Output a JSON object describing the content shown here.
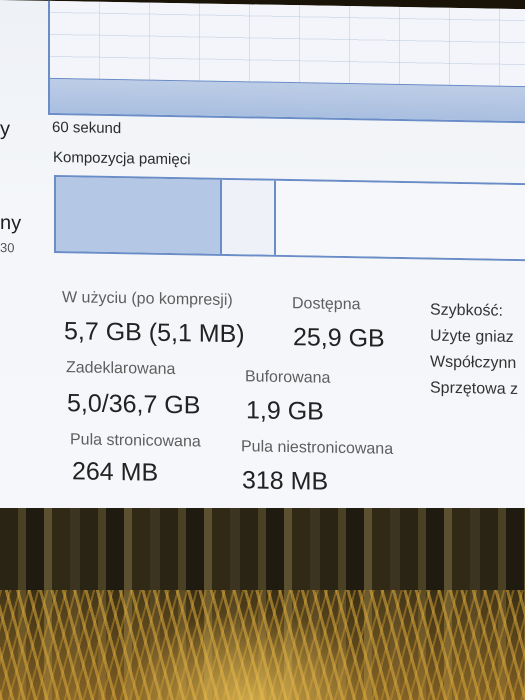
{
  "left_fragments": [
    "y",
    "ny",
    "30"
  ],
  "graph": {
    "time_label": "60 sekund"
  },
  "composition": {
    "title": "Kompozycja pamięci"
  },
  "stats": {
    "in_use": {
      "label": "W użyciu (po kompresji)",
      "value": "5,7 GB (5,1 MB)"
    },
    "available": {
      "label": "Dostępna",
      "value": "25,9 GB"
    },
    "committed": {
      "label": "Zadeklarowana",
      "value": "5,0/36,7 GB"
    },
    "cached": {
      "label": "Buforowana",
      "value": "1,9 GB"
    },
    "paged_pool": {
      "label": "Pula stronicowana",
      "value": "264 MB"
    },
    "non_paged_pool": {
      "label": "Pula niestronicowana",
      "value": "318 MB"
    }
  },
  "right_panel": {
    "items": [
      "Szybkość:",
      "Użyte gniaz",
      "Współczynn",
      "Sprzętowa z"
    ]
  }
}
